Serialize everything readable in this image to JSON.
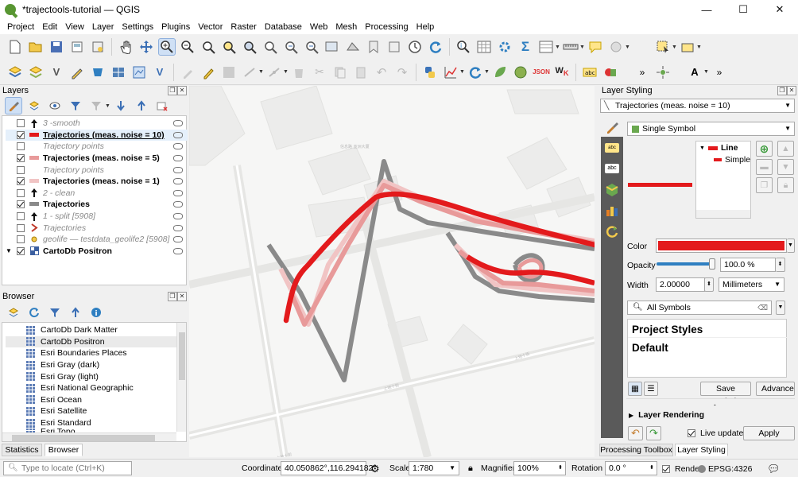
{
  "window": {
    "title": "*trajectools-tutorial — QGIS"
  },
  "menu": [
    "Project",
    "Edit",
    "View",
    "Layer",
    "Settings",
    "Plugins",
    "Vector",
    "Raster",
    "Database",
    "Web",
    "Mesh",
    "Processing",
    "Help"
  ],
  "layers_panel": {
    "title": "Layers",
    "items": [
      {
        "name": "3 -smooth",
        "checked": false,
        "style": "dim",
        "symbol": "arrow-up-icon"
      },
      {
        "name": "Trajectories (meas. noise = 10)",
        "checked": true,
        "style": "bold",
        "symbol": "line-red-icon"
      },
      {
        "name": "Trajectory points",
        "checked": false,
        "style": "dim",
        "symbol": "none"
      },
      {
        "name": "Trajectories (meas. noise = 5)",
        "checked": true,
        "style": "bold",
        "symbol": "line-pink-icon"
      },
      {
        "name": "Trajectory points",
        "checked": false,
        "style": "dim",
        "symbol": "none"
      },
      {
        "name": "Trajectories (meas. noise = 1)",
        "checked": true,
        "style": "bold",
        "symbol": "line-lightpink-icon"
      },
      {
        "name": "2 - clean",
        "checked": false,
        "style": "dim",
        "symbol": "arrow-up-icon"
      },
      {
        "name": "Trajectories",
        "checked": true,
        "style": "bold",
        "symbol": "line-gray-icon"
      },
      {
        "name": "1 - split [5908]",
        "checked": false,
        "style": "dim",
        "symbol": "arrow-up-icon"
      },
      {
        "name": "Trajectories",
        "checked": false,
        "style": "dim",
        "symbol": "dash-red-icon"
      },
      {
        "name": "geolife — testdata_geolife2 [5908]",
        "checked": false,
        "style": "dim",
        "symbol": "point-yellow-icon"
      },
      {
        "name": "CartoDb Positron",
        "checked": true,
        "style": "bold",
        "symbol": "tile-icon"
      }
    ]
  },
  "browser_panel": {
    "title": "Browser",
    "items": [
      "CartoDb Dark Matter",
      "CartoDb Positron",
      "Esri Boundaries Places",
      "Esri Gray (dark)",
      "Esri Gray (light)",
      "Esri National Geographic",
      "Esri Ocean",
      "Esri Satellite",
      "Esri Standard",
      "Esri Topo"
    ],
    "selected_index": 1
  },
  "left_tabs": {
    "statistics": "Statistics",
    "browser": "Browser"
  },
  "styling": {
    "title": "Layer Styling",
    "layer": "Trajectories (meas. noise = 10)",
    "renderer": "Single Symbol",
    "tree_line": "Line",
    "tree_simple": "Simple line",
    "color_label": "Color",
    "color_value": "#e31a1c",
    "opacity_label": "Opacity",
    "opacity_value": "100.0 %",
    "opacity_fraction": 1.0,
    "width_label": "Width",
    "width_value": "2.00000",
    "unit_value": "Millimeters",
    "symbols_filter": "All Symbols",
    "styles": [
      "Project Styles",
      "Default"
    ],
    "save_symbol": "Save Symbol...",
    "advanced": "Advanced",
    "layer_rendering": "Layer Rendering",
    "live_update": "Live update",
    "apply": "Apply"
  },
  "right_tabs": {
    "processing": "Processing Toolbox",
    "styling": "Layer Styling"
  },
  "status": {
    "locate_placeholder": "Type to locate (Ctrl+K)",
    "coordinate_label": "Coordinate",
    "coordinate_value": "40.050862°,116.294182°",
    "scale_label": "Scale",
    "scale_value": "1:780",
    "magnifier_label": "Magnifier",
    "magnifier_value": "100%",
    "rotation_label": "Rotation",
    "rotation_value": "0.0 °",
    "render_label": "Render",
    "crs_value": "EPSG:4326"
  },
  "colors": {
    "accent_red": "#e31a1c",
    "pink": "#e89a9a",
    "light_pink": "#f1c4c4",
    "gray": "#8a8a8a",
    "map_bg": "#f6f6f5"
  }
}
